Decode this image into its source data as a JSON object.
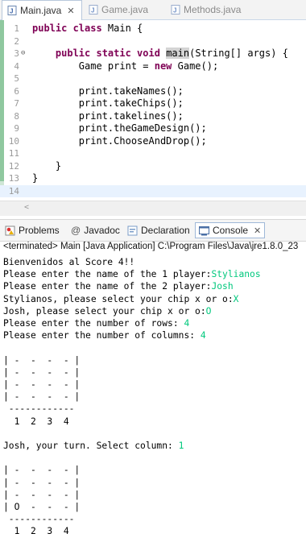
{
  "editor": {
    "tabs": [
      {
        "label": "Main.java",
        "close": "✕"
      },
      {
        "label": "Game.java"
      },
      {
        "label": "Methods.java"
      }
    ],
    "lines": [
      {
        "num": "1",
        "code": [
          {
            "t": "public class",
            "k": "kw"
          },
          {
            "t": " Main {"
          }
        ]
      },
      {
        "num": "2",
        "code": []
      },
      {
        "num": "3",
        "code": [
          {
            "t": "    "
          },
          {
            "t": "public static void",
            "k": "kw"
          },
          {
            "t": " "
          },
          {
            "t": "main",
            "k": "mainhl"
          },
          {
            "t": "(String[] args) {"
          }
        ]
      },
      {
        "num": "4",
        "code": [
          {
            "t": "        Game print = "
          },
          {
            "t": "new",
            "k": "kw"
          },
          {
            "t": " Game();"
          }
        ]
      },
      {
        "num": "5",
        "code": []
      },
      {
        "num": "6",
        "code": [
          {
            "t": "        print.takeNames();"
          }
        ]
      },
      {
        "num": "7",
        "code": [
          {
            "t": "        print.takeChips();"
          }
        ]
      },
      {
        "num": "8",
        "code": [
          {
            "t": "        print.takelines();"
          }
        ]
      },
      {
        "num": "9",
        "code": [
          {
            "t": "        print.theGameDesign();"
          }
        ]
      },
      {
        "num": "10",
        "code": [
          {
            "t": "        print.ChooseAndDrop();"
          }
        ]
      },
      {
        "num": "11",
        "code": []
      },
      {
        "num": "12",
        "code": [
          {
            "t": "    }"
          }
        ]
      },
      {
        "num": "13",
        "code": [
          {
            "t": "}"
          }
        ]
      },
      {
        "num": "14",
        "code": []
      }
    ]
  },
  "views": {
    "tabs": [
      {
        "label": "Problems",
        "icon": "problems-icon"
      },
      {
        "label": "Javadoc",
        "icon": "javadoc-icon"
      },
      {
        "label": "Declaration",
        "icon": "declaration-icon"
      },
      {
        "label": "Console",
        "icon": "console-icon",
        "close": "✕"
      }
    ],
    "terminated": "<terminated> Main [Java Application] C:\\Program Files\\Java\\jre1.8.0_23"
  },
  "console": [
    [
      {
        "t": "Bienvenidos al Score 4!!"
      }
    ],
    [
      {
        "t": "Please enter the name of the 1 player:"
      },
      {
        "t": "Stylianos",
        "i": 1
      }
    ],
    [
      {
        "t": "Please enter the name of the 2 player:"
      },
      {
        "t": "Josh",
        "i": 1
      }
    ],
    [
      {
        "t": "Stylianos, please select your chip x or o:"
      },
      {
        "t": "X",
        "i": 1
      }
    ],
    [
      {
        "t": "Josh, please select your chip x or o:"
      },
      {
        "t": "O",
        "i": 1
      }
    ],
    [
      {
        "t": "Please enter the number of rows: "
      },
      {
        "t": "4",
        "i": 1
      }
    ],
    [
      {
        "t": "Please enter the number of columns: "
      },
      {
        "t": "4",
        "i": 1
      }
    ],
    [],
    [
      {
        "t": "| -  -  -  - |"
      }
    ],
    [
      {
        "t": "| -  -  -  - |"
      }
    ],
    [
      {
        "t": "| -  -  -  - |"
      }
    ],
    [
      {
        "t": "| -  -  -  - |"
      }
    ],
    [
      {
        "t": " ------------"
      }
    ],
    [
      {
        "t": "  1  2  3  4"
      }
    ],
    [],
    [
      {
        "t": "Josh, your turn. Select column: "
      },
      {
        "t": "1",
        "i": 1
      }
    ],
    [],
    [
      {
        "t": "| -  -  -  - |"
      }
    ],
    [
      {
        "t": "| -  -  -  - |"
      }
    ],
    [
      {
        "t": "| -  -  -  - |"
      }
    ],
    [
      {
        "t": "| O  -  -  - |"
      }
    ],
    [
      {
        "t": " ------------"
      }
    ],
    [
      {
        "t": "  1  2  3  4"
      }
    ]
  ],
  "colors": {
    "keyword": "#7f0055",
    "input": "#00c87d",
    "gutter": "#8fc89f",
    "current_line": "#e8f2fe"
  }
}
